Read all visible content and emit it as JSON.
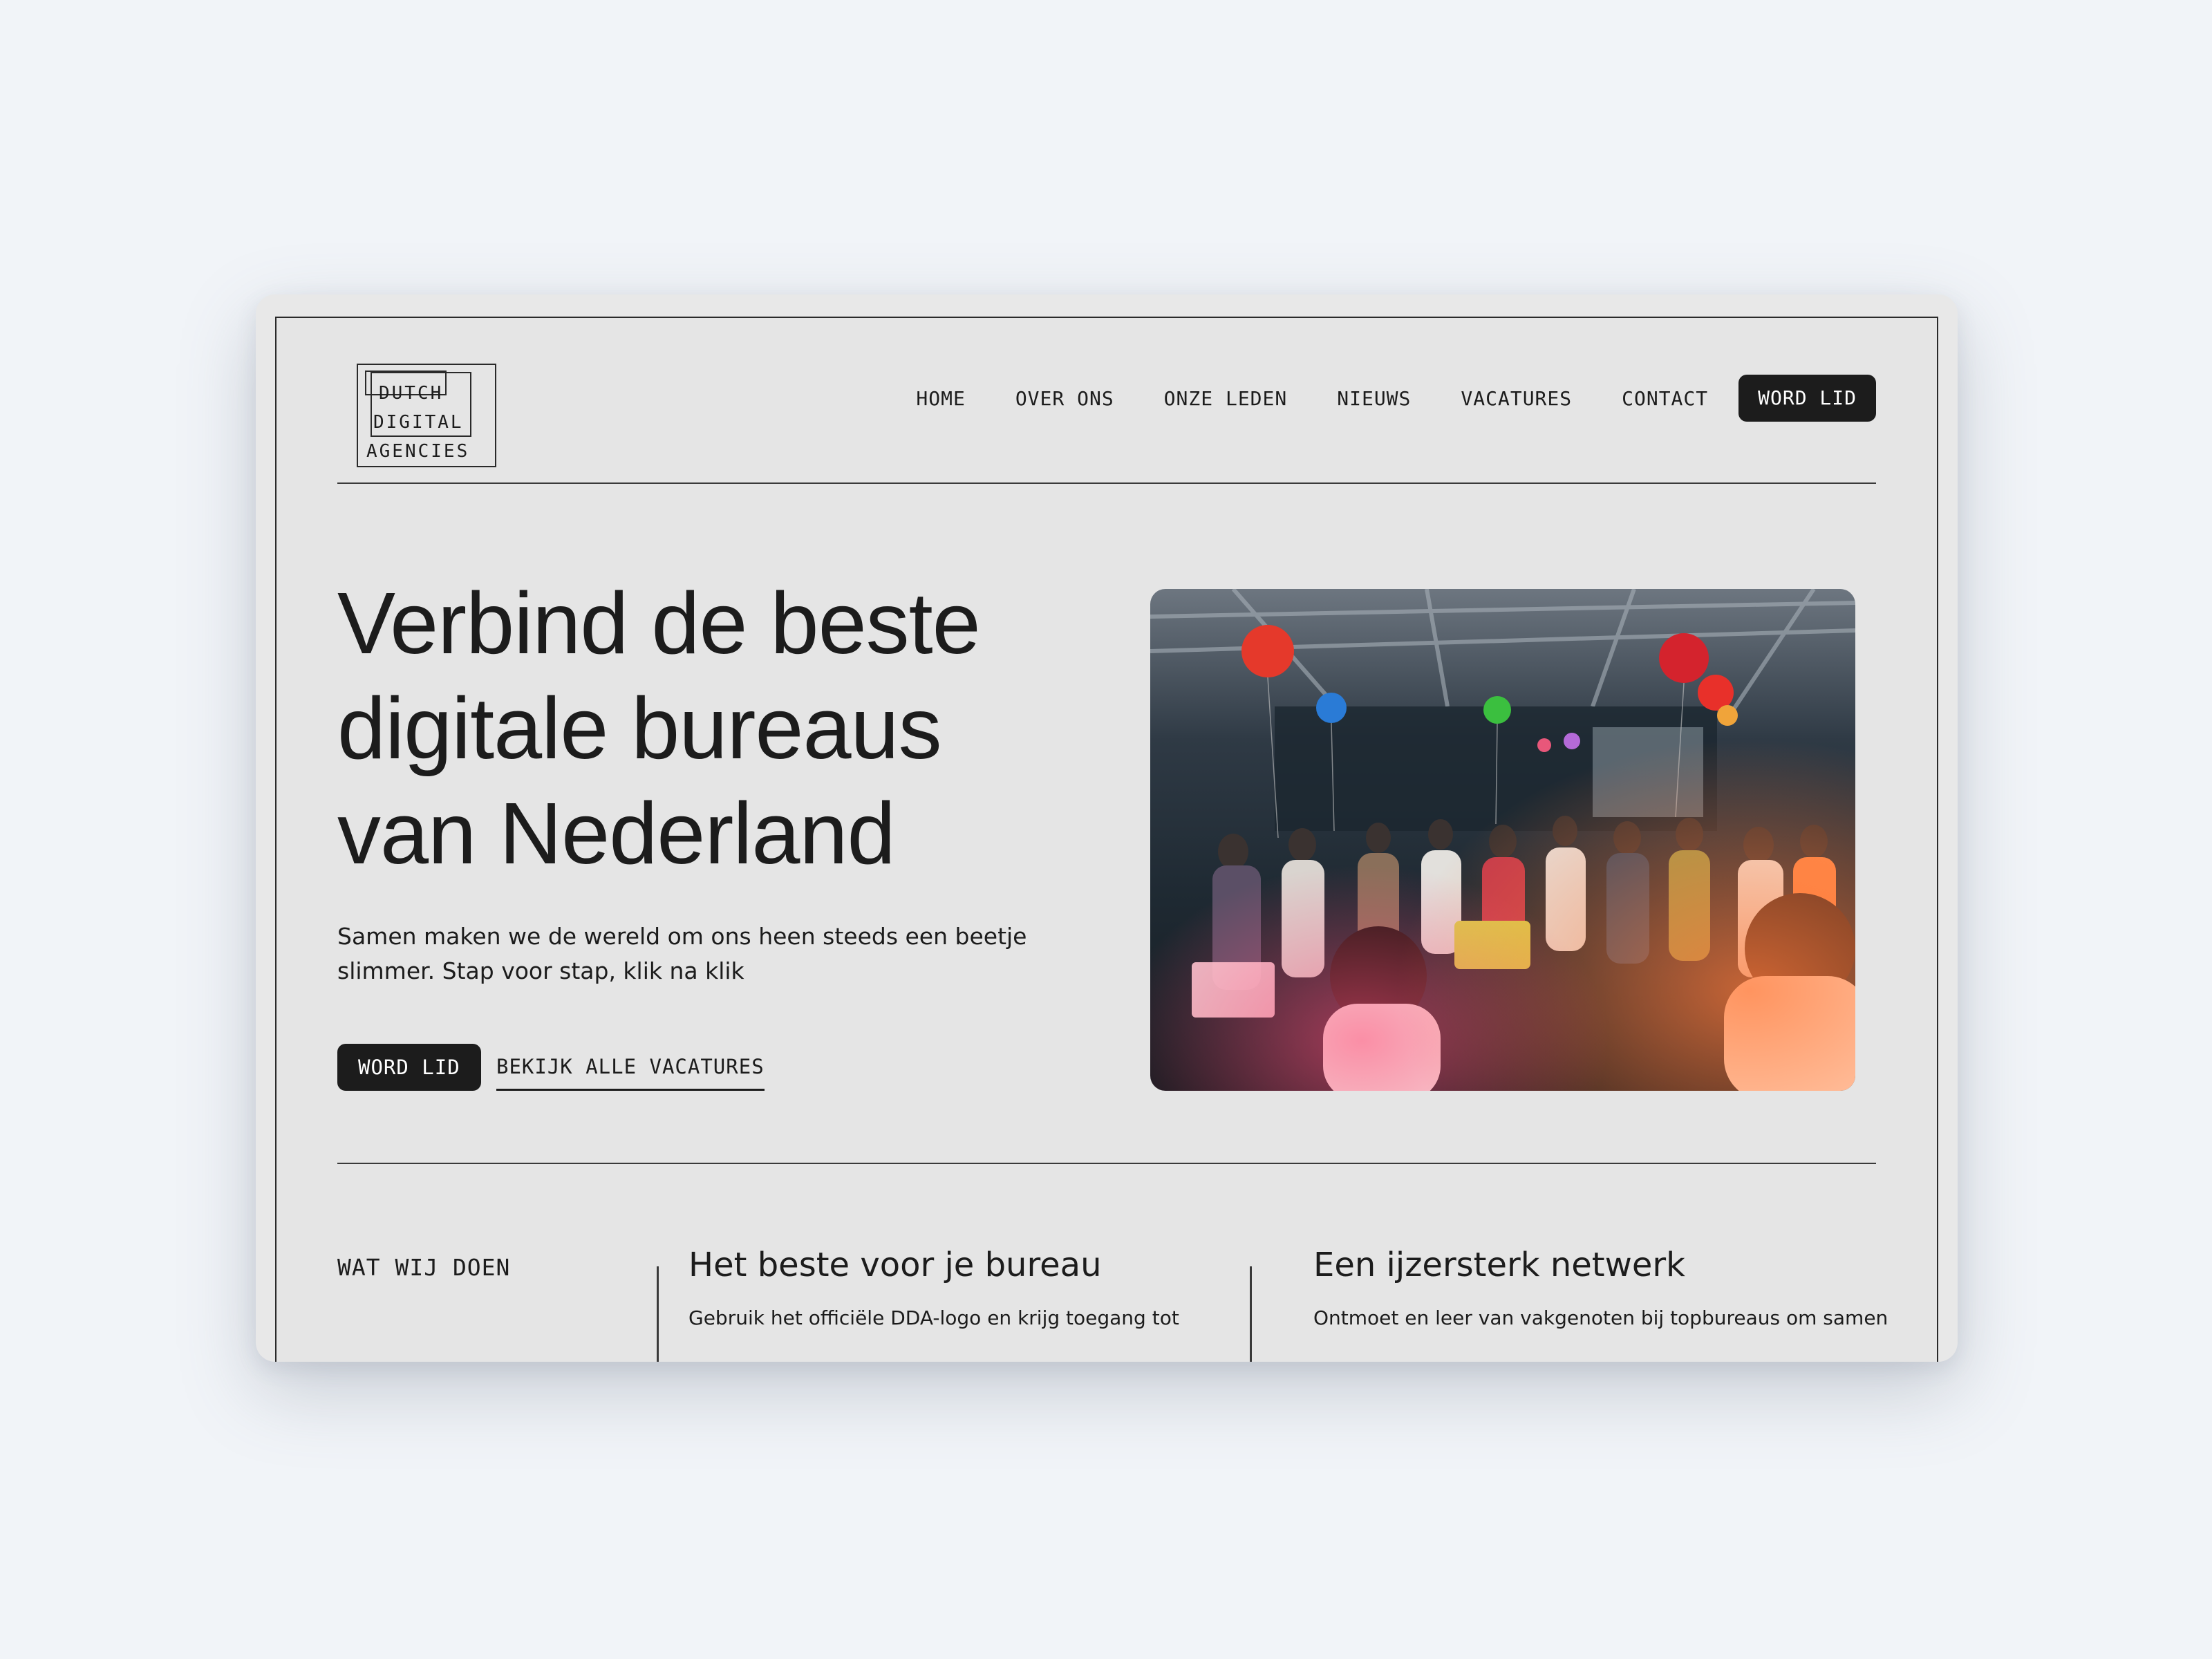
{
  "logo": {
    "line1": "DUTCH",
    "line2": "DIGITAL",
    "line3": "AGENCIES"
  },
  "nav": {
    "items": [
      "HOME",
      "OVER ONS",
      "ONZE LEDEN",
      "NIEUWS",
      "VACATURES",
      "CONTACT"
    ],
    "cta": "WORD LID"
  },
  "hero": {
    "title_lines": [
      "Verbind de beste",
      "digitale bureaus",
      "van Nederland"
    ],
    "subtitle_lines": [
      "Samen maken we de wereld om ons heen steeds een beetje",
      "slimmer. Stap voor stap, klik na klik"
    ],
    "primary_button": "WORD LID",
    "secondary_link": "BEKIJK ALLE VACATURES",
    "image": "event-crowd-photo"
  },
  "section": {
    "label": "WAT WIJ DOEN",
    "columns": [
      {
        "title": "Het beste voor je bureau",
        "text": "Gebruik het officiële DDA-logo en krijg toegang tot"
      },
      {
        "title": "Een ijzersterk netwerk",
        "text": "Ontmoet en leer van vakgenoten bij topbureaus om samen"
      }
    ]
  },
  "colors": {
    "background": "#f1f4f8",
    "page": "#e5e5e5",
    "ink": "#1c1c1c",
    "button": "#1c1c1c"
  }
}
